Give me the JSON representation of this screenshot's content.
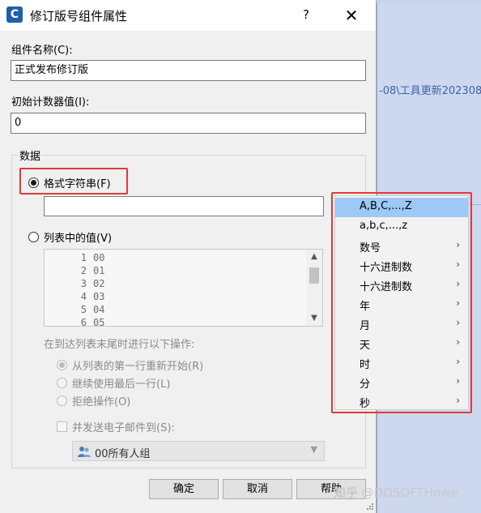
{
  "background": {
    "path_text": "-08\\工具更新202308"
  },
  "dialog": {
    "icon_letter": "C",
    "title": "修订版号组件属性",
    "help_glyph": "?",
    "close_glyph": "✕",
    "component_name_label": "组件名称(C):",
    "component_name_value": "正式发布修订版",
    "initial_counter_label": "初始计数器值(I):",
    "initial_counter_value": "0",
    "data_group_title": "数据",
    "format_string_label": "格式字符串(F)",
    "format_string_value": "",
    "list_values_label": "列表中的值(V)",
    "list_items": [
      {
        "num": "1",
        "val": "00"
      },
      {
        "num": "2",
        "val": "01"
      },
      {
        "num": "3",
        "val": "02"
      },
      {
        "num": "4",
        "val": "03"
      },
      {
        "num": "5",
        "val": "04"
      },
      {
        "num": "6",
        "val": "05"
      }
    ],
    "end_of_list_label": "在到达列表末尾时进行以下操作:",
    "restart_option": "从列表的第一行重新开始(R)",
    "use_last_option": "继续使用最后一行(L)",
    "refuse_option": "拒绝操作(O)",
    "send_email_label": "并发送电子邮件到(S):",
    "email_group_value": "00所有人组",
    "ok_button": "确定",
    "cancel_button": "取消",
    "help_button": "帮助"
  },
  "menu": {
    "items": [
      {
        "label": "A,B,C,...,Z",
        "submenu": false
      },
      {
        "label": "a,b,c,...,z",
        "submenu": false
      },
      {
        "label": "数号",
        "submenu": true
      },
      {
        "label": "十六进制数",
        "submenu": true
      },
      {
        "label": "十六进制数",
        "submenu": true
      },
      {
        "label": "年",
        "submenu": true
      },
      {
        "label": "月",
        "submenu": true
      },
      {
        "label": "天",
        "submenu": true
      },
      {
        "label": "时",
        "submenu": true
      },
      {
        "label": "分",
        "submenu": true
      },
      {
        "label": "秒",
        "submenu": true
      }
    ],
    "arrow_glyph": "›"
  },
  "watermark": {
    "brand": "知乎",
    "handle": "@DDSOFTHowe"
  },
  "colors": {
    "highlight": "#e03a3a",
    "menu_selection": "#9cc9f5",
    "background_app": "#c6d3ec"
  }
}
